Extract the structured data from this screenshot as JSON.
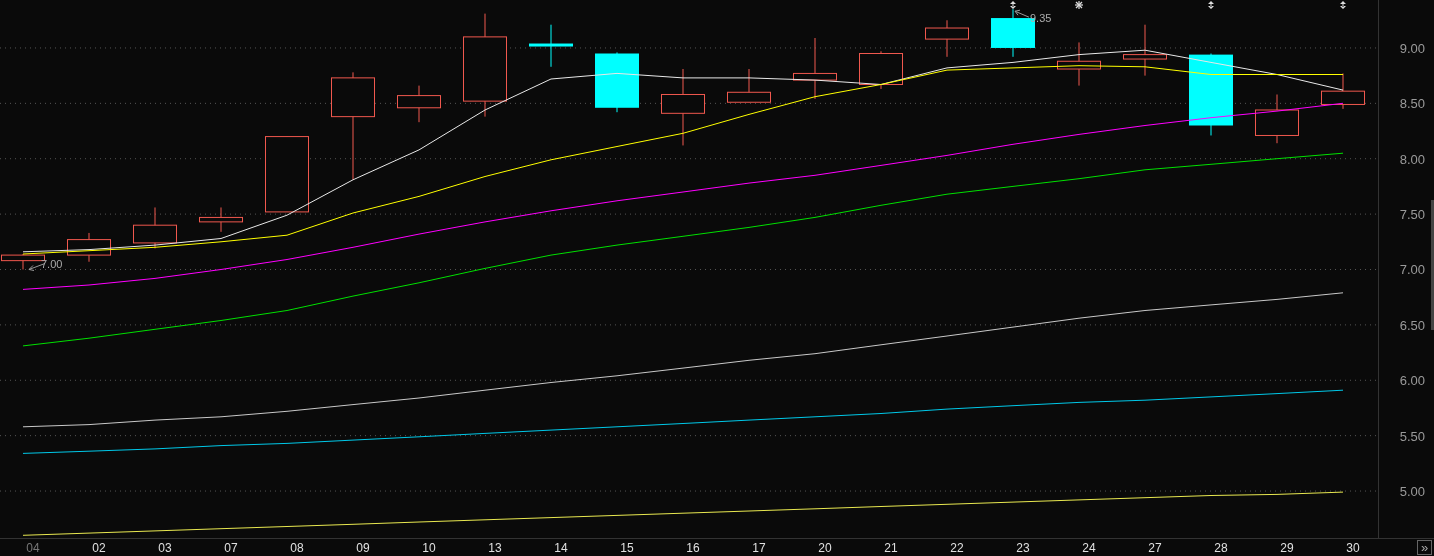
{
  "chart_data": {
    "type": "line",
    "categories": [
      "04",
      "02",
      "03",
      "07",
      "08",
      "09",
      "10",
      "13",
      "14",
      "15",
      "16",
      "17",
      "20",
      "21",
      "22",
      "23",
      "24",
      "27",
      "28",
      "29",
      "30"
    ],
    "ylim": [
      4.576,
      9.433
    ],
    "grid": true,
    "yticks": [
      {
        "value": 5,
        "label": "5.00"
      },
      {
        "value": 5.5,
        "label": "5.50"
      },
      {
        "value": 6,
        "label": "6.00"
      },
      {
        "value": 6.5,
        "label": "6.50"
      },
      {
        "value": 7,
        "label": "7.00"
      },
      {
        "value": 7.5,
        "label": "7.50"
      },
      {
        "value": 8,
        "label": "8.00"
      },
      {
        "value": 8.5,
        "label": "8.50"
      },
      {
        "value": 9,
        "label": "9.00"
      }
    ],
    "series": [
      {
        "color": "#e8e8e8",
        "values": [
          7.16,
          7.18,
          7.22,
          7.28,
          7.49,
          7.81,
          8.08,
          8.44,
          8.72,
          8.77,
          8.73,
          8.73,
          8.71,
          8.67,
          8.82,
          8.87,
          8.94,
          8.98,
          8.87,
          8.76,
          8.62
        ]
      },
      {
        "color": "#ffff00",
        "values": [
          7.14,
          7.17,
          7.2,
          7.25,
          7.31,
          7.51,
          7.66,
          7.84,
          7.99,
          8.11,
          8.23,
          8.4,
          8.56,
          8.67,
          8.8,
          8.82,
          8.84,
          8.83,
          8.76,
          8.76,
          8.76
        ]
      },
      {
        "color": "#ff00ff",
        "values": [
          6.82,
          6.86,
          6.92,
          7.0,
          7.09,
          7.2,
          7.32,
          7.43,
          7.53,
          7.62,
          7.7,
          7.78,
          7.85,
          7.94,
          8.03,
          8.13,
          8.22,
          8.3,
          8.37,
          8.43,
          8.5
        ]
      },
      {
        "color": "#00e000",
        "values": [
          6.31,
          6.38,
          6.46,
          6.54,
          6.63,
          6.76,
          6.88,
          7.01,
          7.13,
          7.22,
          7.3,
          7.38,
          7.47,
          7.58,
          7.68,
          7.75,
          7.82,
          7.9,
          7.95,
          8.0,
          8.05
        ]
      },
      {
        "color": "#c8c8c8",
        "values": [
          5.58,
          5.6,
          5.64,
          5.67,
          5.72,
          5.78,
          5.84,
          5.91,
          5.98,
          6.04,
          6.11,
          6.18,
          6.24,
          6.32,
          6.4,
          6.48,
          6.56,
          6.63,
          6.68,
          6.73,
          6.79
        ]
      },
      {
        "color": "#00c8e8",
        "values": [
          5.34,
          5.36,
          5.38,
          5.41,
          5.43,
          5.46,
          5.49,
          5.52,
          5.55,
          5.58,
          5.61,
          5.64,
          5.67,
          5.7,
          5.74,
          5.77,
          5.8,
          5.82,
          5.85,
          5.88,
          5.91
        ]
      },
      {
        "color": "#e8e850",
        "values": [
          4.6,
          4.62,
          4.64,
          4.66,
          4.68,
          4.7,
          4.72,
          4.74,
          4.76,
          4.78,
          4.8,
          4.82,
          4.84,
          4.86,
          4.88,
          4.9,
          4.92,
          4.94,
          4.96,
          4.97,
          4.99
        ]
      }
    ],
    "annotations": [
      "7.00",
      "9.35"
    ]
  },
  "dimmed_first_label": true,
  "candles": [
    {
      "kind": "up"
    },
    {
      "kind": "up"
    },
    {
      "kind": "up"
    },
    {
      "kind": "up"
    },
    {
      "kind": "up"
    },
    {
      "kind": "up"
    },
    {
      "kind": "up"
    },
    {
      "kind": "up"
    },
    {
      "kind": "down"
    },
    {
      "kind": "down"
    },
    {
      "kind": "up"
    },
    {
      "kind": "up"
    },
    {
      "kind": "up"
    },
    {
      "kind": "up"
    },
    {
      "kind": "up"
    },
    {
      "kind": "down",
      "arrows_marker": true
    },
    {
      "kind": "up",
      "sun_marker": true
    },
    {
      "kind": "up"
    },
    {
      "kind": "down",
      "arrows_marker": true
    },
    {
      "kind": "up"
    },
    {
      "kind": "up",
      "arrows_marker": true
    }
  ],
  "scroll_button": {
    "label": "»"
  }
}
